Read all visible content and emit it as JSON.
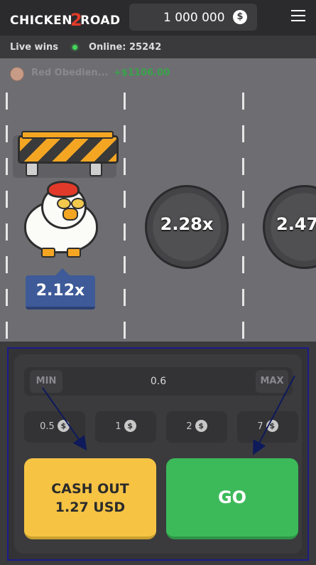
{
  "header": {
    "logo_text_a": "CHICKEN",
    "logo_text_num": "2",
    "logo_text_b": "ROAD",
    "balance": "1 000 000",
    "currency_icon": "$"
  },
  "status": {
    "live_label": "Live wins",
    "online": "Online: 25242"
  },
  "live_win": {
    "name": "Red Obedien...",
    "amount": "+$1106.00"
  },
  "game": {
    "current_multiplier": "2.12x",
    "next_multipliers": [
      "2.28x",
      "2.47"
    ]
  },
  "controls": {
    "min_label": "MIN",
    "max_label": "MAX",
    "bet_value": "0.6",
    "chips": [
      "0.5",
      "1",
      "2",
      "7"
    ],
    "cashout_line1": "CASH OUT",
    "cashout_line2": "1.27 USD",
    "go_label": "GO"
  },
  "colors": {
    "accent_green": "#3cba5a",
    "cashout_yellow": "#f6c343",
    "multiplier_blue": "#3e5a98",
    "annotation_border": "#1b1b8a"
  }
}
